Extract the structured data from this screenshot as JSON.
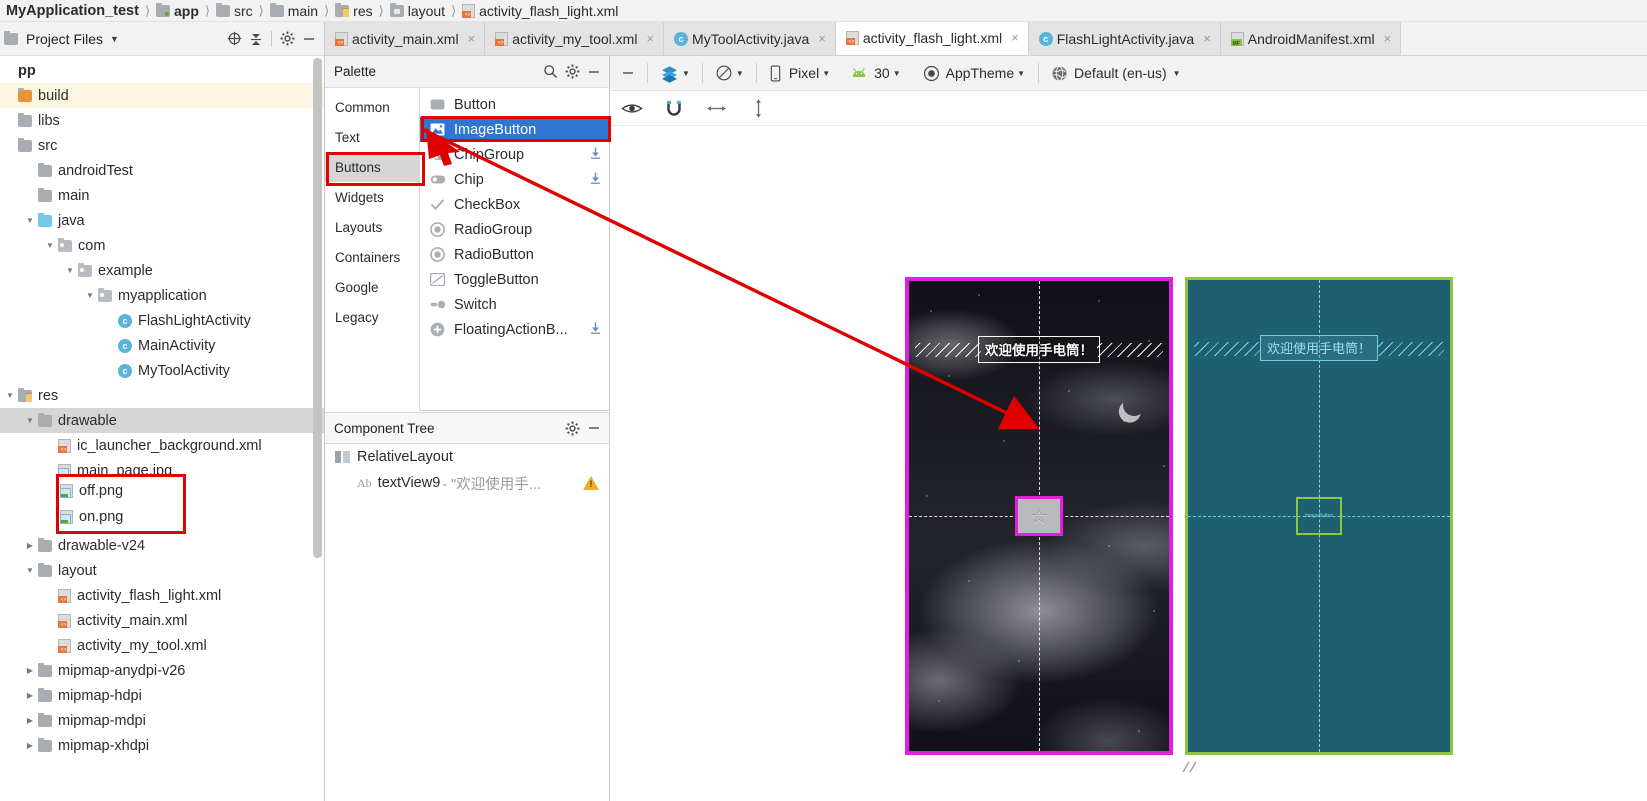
{
  "breadcrumb": [
    {
      "label": "MyApplication_test",
      "icon": "none"
    },
    {
      "label": "app",
      "icon": "folder-module-icon"
    },
    {
      "label": "src",
      "icon": "folder-icon"
    },
    {
      "label": "main",
      "icon": "folder-icon"
    },
    {
      "label": "res",
      "icon": "folder-res-icon"
    },
    {
      "label": "layout",
      "icon": "folder-layout-icon"
    },
    {
      "label": "activity_flash_light.xml",
      "icon": "xml-file-icon"
    }
  ],
  "project_panel": {
    "title": "Project Files",
    "buttons": [
      {
        "name": "select-opened-file-button",
        "glyph": "⊕"
      },
      {
        "name": "collapse-all-button",
        "glyph": "⨒"
      },
      {
        "name": "settings-gear-button",
        "glyph": "⚙"
      },
      {
        "name": "hide-panel-button",
        "glyph": "−"
      }
    ],
    "tree": [
      {
        "label": "pp",
        "depth": 0,
        "twist": "",
        "icon": "none",
        "state": "normal",
        "bold": true
      },
      {
        "label": "build",
        "depth": 0,
        "twist": "",
        "icon": "folder-build-icon",
        "state": "highlight"
      },
      {
        "label": "libs",
        "depth": 0,
        "twist": "",
        "icon": "folder-icon",
        "state": "normal"
      },
      {
        "label": "src",
        "depth": 0,
        "twist": "",
        "icon": "folder-icon",
        "state": "normal"
      },
      {
        "label": "androidTest",
        "depth": 1,
        "twist": "",
        "icon": "folder-icon",
        "state": "normal"
      },
      {
        "label": "main",
        "depth": 1,
        "twist": "",
        "icon": "folder-icon",
        "state": "normal"
      },
      {
        "label": "java",
        "depth": 1,
        "twist": "expanded",
        "icon": "folder-java-icon",
        "state": "normal"
      },
      {
        "label": "com",
        "depth": 2,
        "twist": "expanded",
        "icon": "folder-package-icon",
        "state": "normal"
      },
      {
        "label": "example",
        "depth": 3,
        "twist": "expanded",
        "icon": "folder-package-icon",
        "state": "normal"
      },
      {
        "label": "myapplication",
        "depth": 4,
        "twist": "expanded",
        "icon": "folder-package-icon",
        "state": "normal"
      },
      {
        "label": "FlashLightActivity",
        "depth": 5,
        "twist": "",
        "icon": "java-class-icon",
        "state": "normal"
      },
      {
        "label": "MainActivity",
        "depth": 5,
        "twist": "",
        "icon": "java-class-icon",
        "state": "normal"
      },
      {
        "label": "MyToolActivity",
        "depth": 5,
        "twist": "",
        "icon": "java-class-icon",
        "state": "normal"
      },
      {
        "label": "res",
        "depth": 0,
        "twist": "expanded",
        "icon": "folder-res-icon",
        "state": "normal"
      },
      {
        "label": "drawable",
        "depth": 1,
        "twist": "expanded",
        "icon": "folder-icon",
        "state": "selected"
      },
      {
        "label": "ic_launcher_background.xml",
        "depth": 2,
        "twist": "",
        "icon": "xml-file-icon",
        "state": "normal"
      },
      {
        "label": "main_page.jpg",
        "depth": 2,
        "twist": "",
        "icon": "image-file-icon",
        "state": "normal"
      },
      {
        "label": "off.png",
        "depth": 2,
        "twist": "",
        "icon": "image-file-icon",
        "state": "normal"
      },
      {
        "label": "on.png",
        "depth": 2,
        "twist": "",
        "icon": "image-file-icon",
        "state": "normal"
      },
      {
        "label": "drawable-v24",
        "depth": 1,
        "twist": "collapsed",
        "icon": "folder-icon",
        "state": "normal"
      },
      {
        "label": "layout",
        "depth": 1,
        "twist": "expanded",
        "icon": "folder-icon",
        "state": "normal"
      },
      {
        "label": "activity_flash_light.xml",
        "depth": 2,
        "twist": "",
        "icon": "xml-file-icon",
        "state": "normal"
      },
      {
        "label": "activity_main.xml",
        "depth": 2,
        "twist": "",
        "icon": "xml-file-icon",
        "state": "normal"
      },
      {
        "label": "activity_my_tool.xml",
        "depth": 2,
        "twist": "",
        "icon": "xml-file-icon",
        "state": "normal"
      },
      {
        "label": "mipmap-anydpi-v26",
        "depth": 1,
        "twist": "collapsed",
        "icon": "folder-icon",
        "state": "normal"
      },
      {
        "label": "mipmap-hdpi",
        "depth": 1,
        "twist": "collapsed",
        "icon": "folder-icon",
        "state": "normal"
      },
      {
        "label": "mipmap-mdpi",
        "depth": 1,
        "twist": "collapsed",
        "icon": "folder-icon",
        "state": "normal"
      },
      {
        "label": "mipmap-xhdpi",
        "depth": 1,
        "twist": "collapsed",
        "icon": "folder-icon",
        "state": "normal"
      }
    ]
  },
  "editor_tabs": [
    {
      "label": "activity_main.xml",
      "icon": "xml-file-icon",
      "active": false
    },
    {
      "label": "activity_my_tool.xml",
      "icon": "xml-file-icon",
      "active": false
    },
    {
      "label": "MyToolActivity.java",
      "icon": "java-class-icon",
      "active": false
    },
    {
      "label": "activity_flash_light.xml",
      "icon": "xml-file-icon",
      "active": true
    },
    {
      "label": "FlashLightActivity.java",
      "icon": "java-class-icon",
      "active": false
    },
    {
      "label": "AndroidManifest.xml",
      "icon": "manifest-file-icon",
      "active": false
    }
  ],
  "palette": {
    "title": "Palette",
    "search_icon": "search-icon",
    "gear_icon": "gear-icon",
    "minimize_icon": "minimize-icon",
    "categories": [
      {
        "label": "Common",
        "selected": false
      },
      {
        "label": "Text",
        "selected": false
      },
      {
        "label": "Buttons",
        "selected": true
      },
      {
        "label": "Widgets",
        "selected": false
      },
      {
        "label": "Layouts",
        "selected": false
      },
      {
        "label": "Containers",
        "selected": false
      },
      {
        "label": "Google",
        "selected": false
      },
      {
        "label": "Legacy",
        "selected": false
      }
    ],
    "items": [
      {
        "label": "Button",
        "icon": "button-icon",
        "selected": false,
        "download": false
      },
      {
        "label": "ImageButton",
        "icon": "image-button-icon",
        "selected": true,
        "download": false
      },
      {
        "label": "ChipGroup",
        "icon": "chip-group-icon",
        "selected": false,
        "download": true
      },
      {
        "label": "Chip",
        "icon": "chip-icon",
        "selected": false,
        "download": true
      },
      {
        "label": "CheckBox",
        "icon": "checkbox-icon",
        "selected": false,
        "download": false
      },
      {
        "label": "RadioGroup",
        "icon": "radio-group-icon",
        "selected": false,
        "download": false
      },
      {
        "label": "RadioButton",
        "icon": "radio-button-icon",
        "selected": false,
        "download": false
      },
      {
        "label": "ToggleButton",
        "icon": "toggle-button-icon",
        "selected": false,
        "download": false
      },
      {
        "label": "Switch",
        "icon": "switch-icon",
        "selected": false,
        "download": false
      },
      {
        "label": "FloatingActionB...",
        "icon": "floating-action-button-icon",
        "selected": false,
        "download": true
      }
    ]
  },
  "component_tree": {
    "title": "Component Tree",
    "gear_icon": "gear-icon",
    "minimize_icon": "minimize-icon",
    "nodes": [
      {
        "label": "RelativeLayout",
        "icon": "relative-layout-icon",
        "depth": 0,
        "warning": false,
        "suffix": ""
      },
      {
        "label": "textView9",
        "icon": "text-view-icon",
        "depth": 1,
        "warning": true,
        "suffix": "- \"欢迎使用手..."
      }
    ]
  },
  "design_toolbar": {
    "minimize_icon": "minimize-icon",
    "design_mode": {
      "label": "",
      "icon": "design-surface-icon"
    },
    "orientation": {
      "label": "",
      "icon": "rotate-icon"
    },
    "device": {
      "label": "Pixel",
      "icon": "phone-icon"
    },
    "api_level": {
      "label": "30",
      "icon": "android-icon"
    },
    "theme": {
      "label": "AppTheme",
      "icon": "theme-icon"
    },
    "locale": {
      "label": "Default (en-us)",
      "icon": "globe-icon"
    },
    "view_options": [
      {
        "name": "show-layout-decorations-icon",
        "glyph": "eye"
      },
      {
        "name": "magnet-autoconnect-icon",
        "glyph": "magnet"
      },
      {
        "name": "horizontal-guideline-icon",
        "glyph": "h-arrow"
      },
      {
        "name": "vertical-guideline-icon",
        "glyph": "v-arrow"
      }
    ]
  },
  "canvas": {
    "design_view": {
      "label": "design-preview",
      "textview_text": "欢迎使用手电筒！",
      "selection_color": "#e020e0",
      "image_button_icon": "star-placeholder-icon"
    },
    "blueprint_view": {
      "label": "blueprint-preview",
      "textview_text": "欢迎使用手电筒！",
      "selection_color": "#8cc63f",
      "background_color": "#1f6070"
    }
  },
  "annotations": {
    "color": "#e00000",
    "boxes": [
      {
        "name": "buttons-category-highlight"
      },
      {
        "name": "imagebutton-item-highlight"
      },
      {
        "name": "png-files-highlight"
      }
    ],
    "arrow": {
      "name": "drag-arrow",
      "from": "ImageButton palette item",
      "to": "ImageButton on design preview"
    }
  }
}
